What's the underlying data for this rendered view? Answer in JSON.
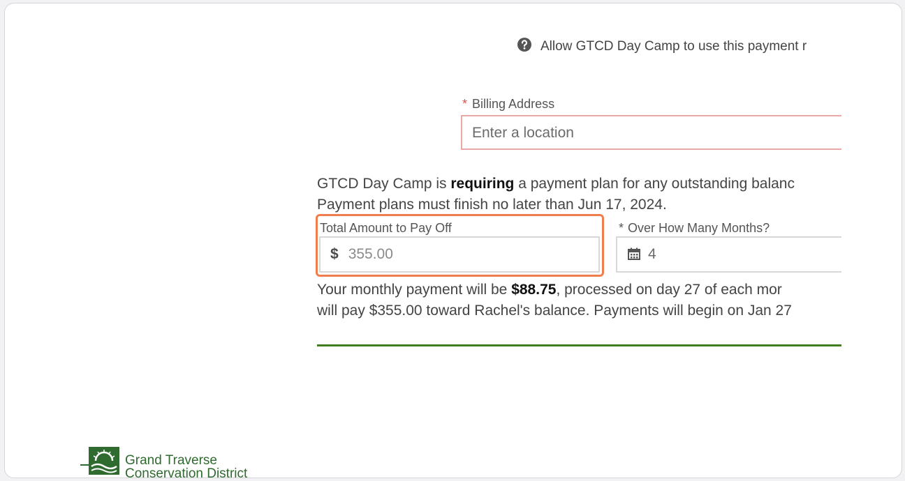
{
  "payment": {
    "allow_text": "Allow GTCD Day Camp to use this payment r",
    "billing_label": "Billing Address",
    "billing_required_mark": "*",
    "billing_placeholder": "Enter a location",
    "plan_text_prefix": "GTCD Day Camp is ",
    "plan_text_bold": "requiring",
    "plan_text_suffix": " a payment plan for any outstanding balanc",
    "plan_deadline": "Payment plans must finish no later than Jun 17, 2024.",
    "amount_label": "Total Amount to Pay Off",
    "amount_currency": "$",
    "amount_value": "355.00",
    "months_required_mark": "*",
    "months_label": "Over How Many Months?",
    "months_value": "4",
    "monthly_prefix": "Your monthly payment will be ",
    "monthly_amount": "$88.75",
    "monthly_suffix": ", processed on day 27 of each mor",
    "monthly_line2": "will pay $355.00 toward Rachel's balance. Payments will begin on Jan 27"
  },
  "logo": {
    "line1": "Grand Traverse",
    "line2": "Conservation District"
  },
  "colors": {
    "highlight": "#f07d4e",
    "required": "#d9534f",
    "divider": "#3f7d1f",
    "brand_green": "#2f6a2f"
  }
}
